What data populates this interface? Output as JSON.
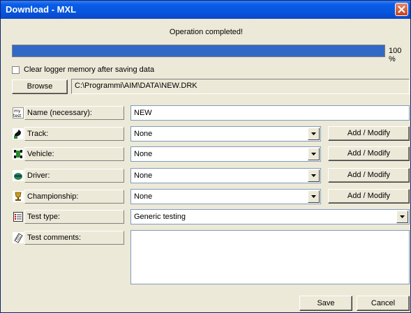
{
  "window": {
    "title": "Download - MXL",
    "close_icon": "close-icon"
  },
  "status": {
    "message": "Operation completed!",
    "progress_fraction": 1.0,
    "progress_label": "100 %"
  },
  "options": {
    "clear_memory_label": "Clear logger memory after saving data",
    "clear_memory_checked": false
  },
  "file": {
    "browse_label": "Browse",
    "path": "C:\\Programmi\\AIM\\DATA\\NEW.DRK"
  },
  "fields": {
    "name": {
      "icon": "mytest-icon",
      "label": "Name (necessary):",
      "value": "NEW"
    },
    "track": {
      "icon": "track-icon",
      "label": "Track:",
      "value": "None",
      "button": "Add / Modify"
    },
    "vehicle": {
      "icon": "vehicle-icon",
      "label": "Vehicle:",
      "value": "None",
      "button": "Add / Modify"
    },
    "driver": {
      "icon": "driver-icon",
      "label": "Driver:",
      "value": "None",
      "button": "Add / Modify"
    },
    "championship": {
      "icon": "trophy-icon",
      "label": "Championship:",
      "value": "None",
      "button": "Add / Modify"
    },
    "test_type": {
      "icon": "list-icon",
      "label": "Test type:",
      "value": "Generic testing"
    },
    "comments": {
      "icon": "notepad-icon",
      "label": "Test comments:",
      "value": ""
    }
  },
  "actions": {
    "save_label": "Save",
    "cancel_label": "Cancel"
  },
  "colors": {
    "titlebar": "#0656de",
    "progress": "#3169c6",
    "dialog_bg": "#ece9d8"
  }
}
